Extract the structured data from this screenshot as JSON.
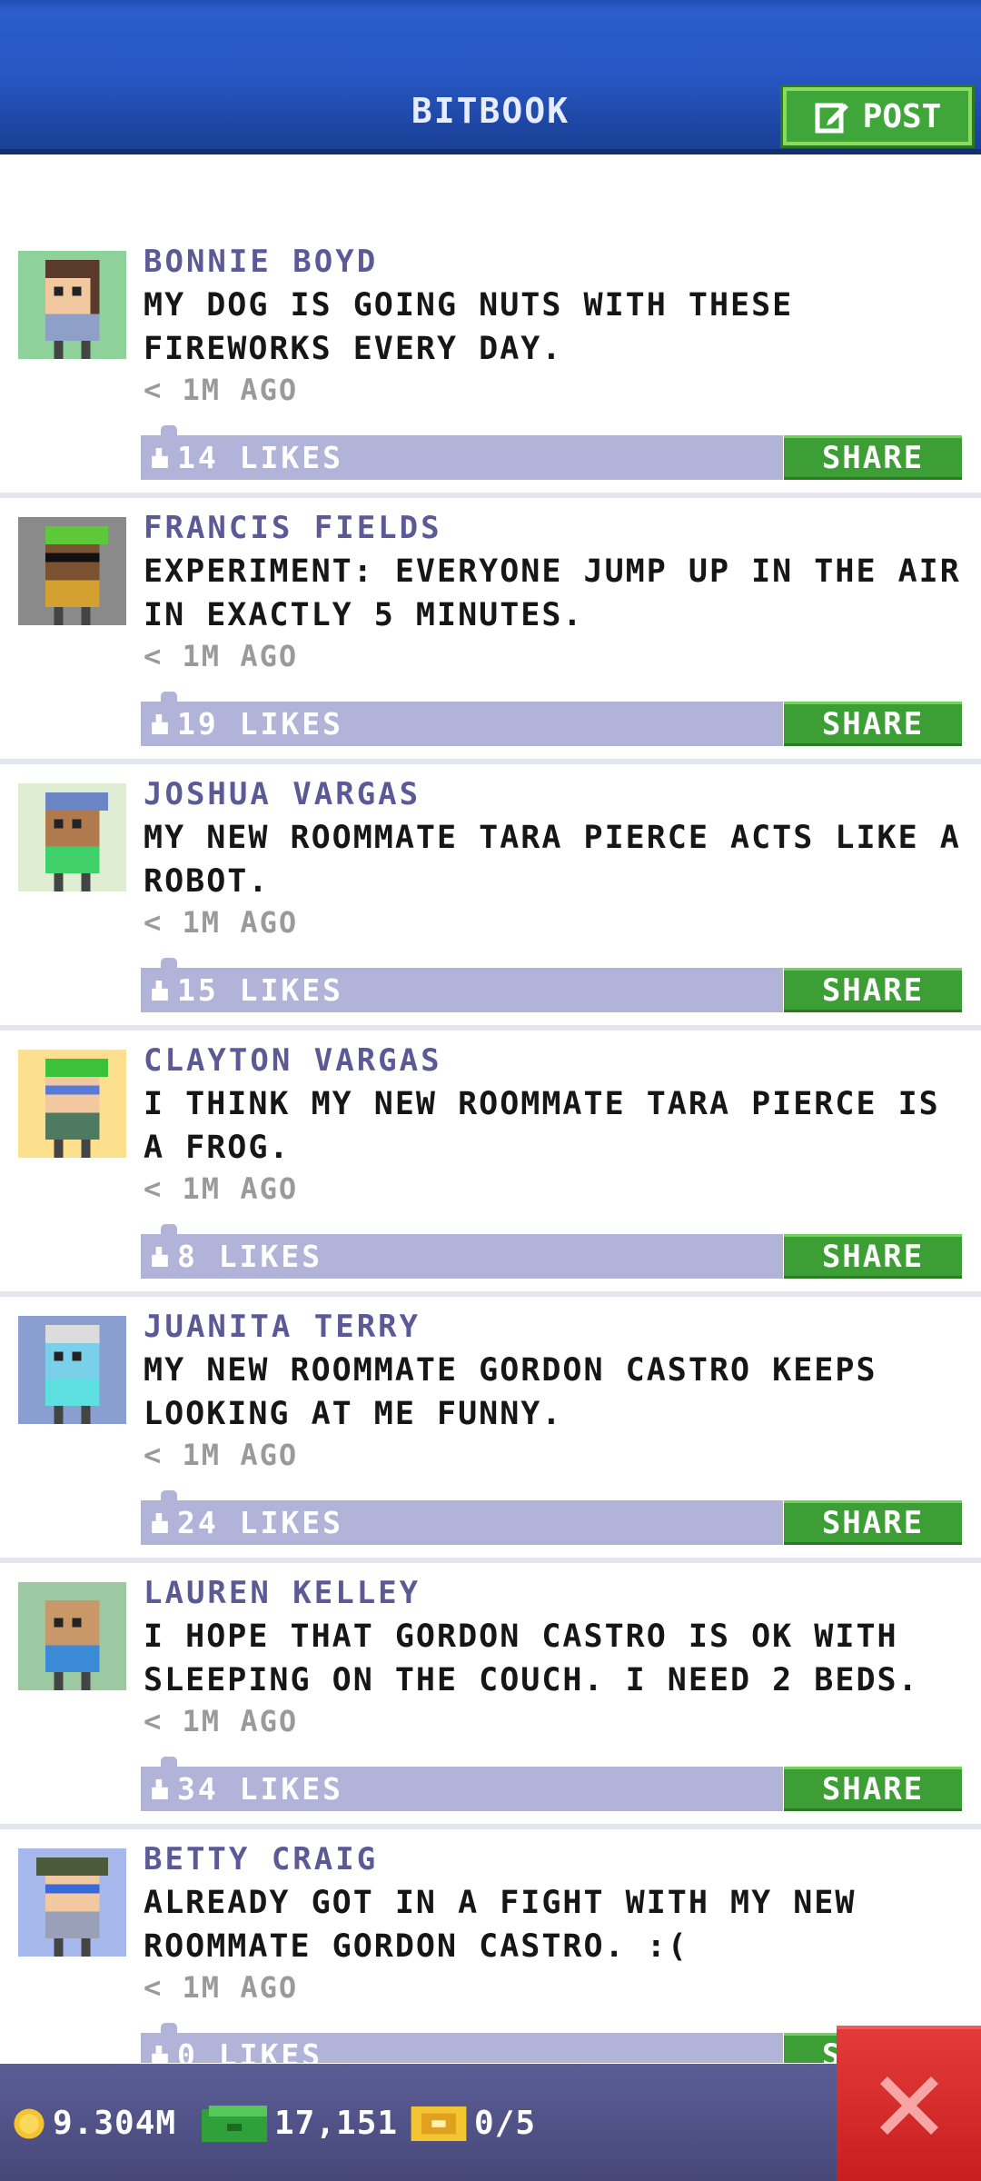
{
  "header": {
    "title": "BITBOOK",
    "post_label": "POST"
  },
  "posts": [
    {
      "name": "BONNIE BOYD",
      "text": "MY DOG IS GOING NUTS WITH THESE FIREWORKS EVERY DAY.",
      "time": "< 1M AGO",
      "likes": "14 LIKES",
      "share": "SHARE"
    },
    {
      "name": "FRANCIS FIELDS",
      "text": "EXPERIMENT: EVERYONE JUMP UP IN THE AIR IN EXACTLY 5 MINUTES.",
      "time": "< 1M AGO",
      "likes": "19 LIKES",
      "share": "SHARE"
    },
    {
      "name": "JOSHUA VARGAS",
      "text": "MY NEW ROOMMATE TARA PIERCE ACTS LIKE A ROBOT.",
      "time": "< 1M AGO",
      "likes": "15 LIKES",
      "share": "SHARE"
    },
    {
      "name": "CLAYTON VARGAS",
      "text": "I THINK MY NEW ROOMMATE TARA PIERCE IS A FROG.",
      "time": "< 1M AGO",
      "likes": "8 LIKES",
      "share": "SHARE"
    },
    {
      "name": "JUANITA TERRY",
      "text": "MY NEW ROOMMATE GORDON CASTRO KEEPS LOOKING AT ME FUNNY.",
      "time": "< 1M AGO",
      "likes": "24 LIKES",
      "share": "SHARE"
    },
    {
      "name": "LAUREN KELLEY",
      "text": "I HOPE THAT GORDON CASTRO IS OK WITH SLEEPING ON THE COUCH. I NEED 2 BEDS.",
      "time": "< 1M AGO",
      "likes": "34 LIKES",
      "share": "SHARE"
    },
    {
      "name": "BETTY CRAIG",
      "text": "ALREADY GOT IN A FIGHT WITH MY NEW ROOMMATE GORDON CASTRO. :(",
      "time": "< 1M AGO",
      "likes": "0 LIKES",
      "share": "SHARE"
    }
  ],
  "status": {
    "coins": "9.304M",
    "bux": "17,151",
    "tickets": "0/5"
  },
  "colors": {
    "header": "#2758c4",
    "name": "#5c5a96",
    "likes_bar": "#b1b3d8",
    "share": "#3d9e36",
    "close": "#d92a2a",
    "bottom_bar": "#4f5187"
  }
}
